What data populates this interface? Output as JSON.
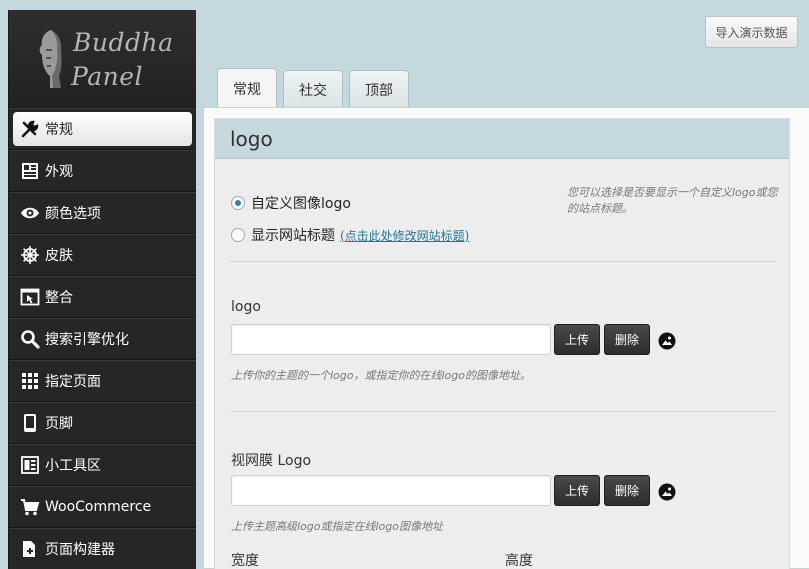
{
  "brand": {
    "line1": "Buddha",
    "line2": "Panel"
  },
  "import_button": "导入演示数据",
  "sidebar": {
    "items": [
      {
        "label": "常规",
        "icon": "wrench-icon",
        "active": true
      },
      {
        "label": "外观",
        "icon": "layout-icon"
      },
      {
        "label": "颜色选项",
        "icon": "eye-icon"
      },
      {
        "label": "皮肤",
        "icon": "helm-icon"
      },
      {
        "label": "整合",
        "icon": "window-cursor-icon"
      },
      {
        "label": "搜索引擎优化",
        "icon": "search-icon"
      },
      {
        "label": "指定页面",
        "icon": "grid-icon"
      },
      {
        "label": "页脚",
        "icon": "phone-icon"
      },
      {
        "label": "小工具区",
        "icon": "widgets-icon"
      },
      {
        "label": "WooCommerce",
        "icon": "cart-icon"
      },
      {
        "label": "页面构建器",
        "icon": "puzzle-icon"
      }
    ]
  },
  "tabs": [
    {
      "label": "常规",
      "active": true
    },
    {
      "label": "社交"
    },
    {
      "label": "顶部"
    }
  ],
  "section": {
    "title": "logo",
    "radio_custom": "自定义图像logo",
    "radio_site_title": "显示网站标题",
    "site_title_link": "(点击此处修改网站标题)",
    "description": "您可以选择是否要显示一个自定义logo或您的站点标题。",
    "logo_label": "logo",
    "logo_input_value": "",
    "upload_label": "上传",
    "delete_label": "删除",
    "logo_hint": "上传你的主题的一个logo，或指定你的在线logo的图像地址。",
    "retina_label": "视网膜 Logo",
    "retina_input_value": "",
    "retina_hint": "上传主题高级logo或指定在线logo图像地址",
    "width_label": "宽度",
    "height_label": "高度"
  }
}
